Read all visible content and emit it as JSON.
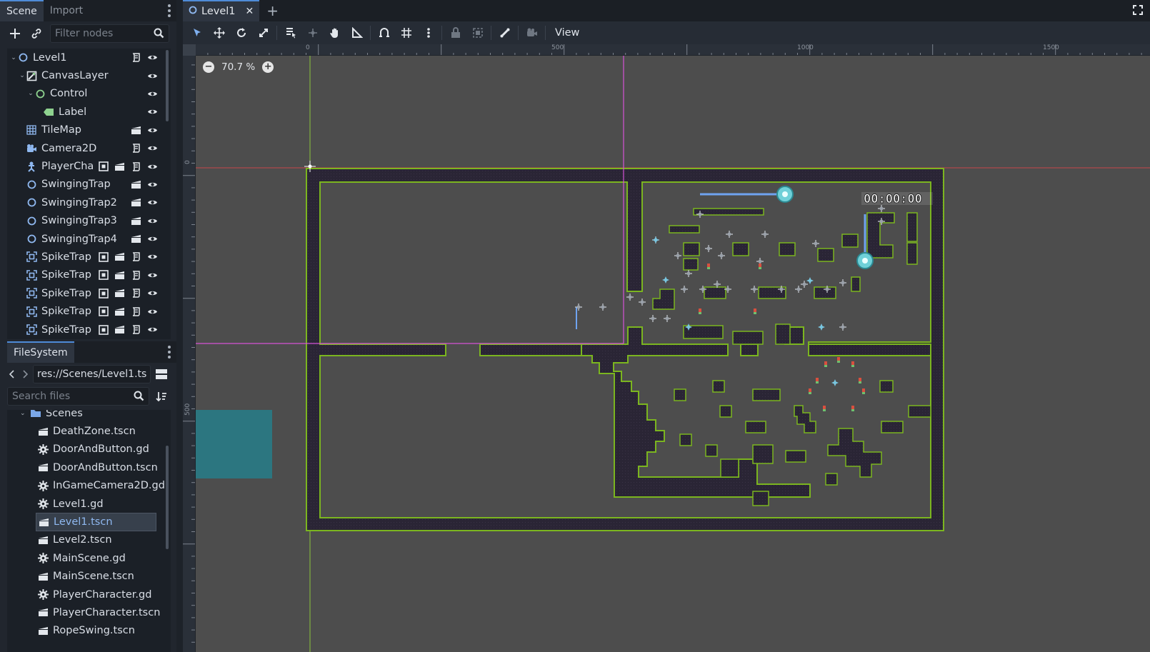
{
  "left_dock": {
    "tabs": [
      "Scene",
      "Import"
    ],
    "filter_placeholder": "Filter nodes",
    "tree": [
      {
        "label": "Level1",
        "icon": "node2d-circle-icon",
        "indent": 0,
        "arrow": "v"
      },
      {
        "label": "CanvasLayer",
        "icon": "canvas-layer-icon",
        "indent": 1,
        "arrow": "v"
      },
      {
        "label": "Control",
        "icon": "control-circle-icon",
        "indent": 2,
        "arrow": "v"
      },
      {
        "label": "Label",
        "icon": "label-tag-icon",
        "indent": 3,
        "arrow": ""
      },
      {
        "label": "TileMap",
        "icon": "tilemap-grid-icon",
        "indent": 1,
        "arrow": ""
      },
      {
        "label": "Camera2D",
        "icon": "camera-icon",
        "indent": 1,
        "arrow": ""
      },
      {
        "label": "PlayerCha",
        "icon": "character-icon",
        "indent": 1,
        "arrow": ""
      },
      {
        "label": "SwingingTrap",
        "icon": "node-circle-icon",
        "indent": 1,
        "arrow": ""
      },
      {
        "label": "SwingingTrap2",
        "icon": "node-circle-icon",
        "indent": 1,
        "arrow": ""
      },
      {
        "label": "SwingingTrap3",
        "icon": "node-circle-icon",
        "indent": 1,
        "arrow": ""
      },
      {
        "label": "SwingingTrap4",
        "icon": "node-circle-icon",
        "indent": 1,
        "arrow": ""
      },
      {
        "label": "SpikeTrap",
        "icon": "area-icon",
        "indent": 1,
        "arrow": ""
      },
      {
        "label": "SpikeTrap",
        "icon": "area-icon",
        "indent": 1,
        "arrow": ""
      },
      {
        "label": "SpikeTrap",
        "icon": "area-icon",
        "indent": 1,
        "arrow": ""
      },
      {
        "label": "SpikeTrap",
        "icon": "area-icon",
        "indent": 1,
        "arrow": ""
      },
      {
        "label": "SpikeTrap",
        "icon": "area-icon",
        "indent": 1,
        "arrow": ""
      }
    ],
    "filesystem_tab": "FileSystem",
    "path": "res://Scenes/Level1.ts",
    "search_placeholder": "Search files",
    "files": [
      {
        "label": "Scenes",
        "type": "folder"
      },
      {
        "label": "DeathZone.tscn",
        "type": "scene"
      },
      {
        "label": "DoorAndButton.gd",
        "type": "script"
      },
      {
        "label": "DoorAndButton.tscn",
        "type": "scene"
      },
      {
        "label": "InGameCamera2D.gd",
        "type": "script"
      },
      {
        "label": "Level1.gd",
        "type": "script"
      },
      {
        "label": "Level1.tscn",
        "type": "scene",
        "selected": true
      },
      {
        "label": "Level2.tscn",
        "type": "scene"
      },
      {
        "label": "MainScene.gd",
        "type": "script"
      },
      {
        "label": "MainScene.tscn",
        "type": "scene"
      },
      {
        "label": "PlayerCharacter.gd",
        "type": "script"
      },
      {
        "label": "PlayerCharacter.tscn",
        "type": "scene"
      },
      {
        "label": "RopeSwing.tscn",
        "type": "scene"
      }
    ]
  },
  "editor": {
    "scene_tab": "Level1",
    "view_menu": "View",
    "zoom": "70.7 %",
    "ruler_top": [
      "0",
      "500",
      "1000",
      "1500"
    ],
    "ruler_left": [
      "0",
      "500"
    ],
    "hud_timer": "00:00:00"
  },
  "colors": {
    "accent": "#4e8bd8",
    "viewport_bg": "#4d4d4d",
    "tile_dark": "#2a2535",
    "tile_edge": "#7bb51f",
    "guide_magenta": "#d553d6",
    "axis_red": "#c8474b",
    "axis_green": "#89c53a",
    "camera_teal": "#2c7680"
  }
}
